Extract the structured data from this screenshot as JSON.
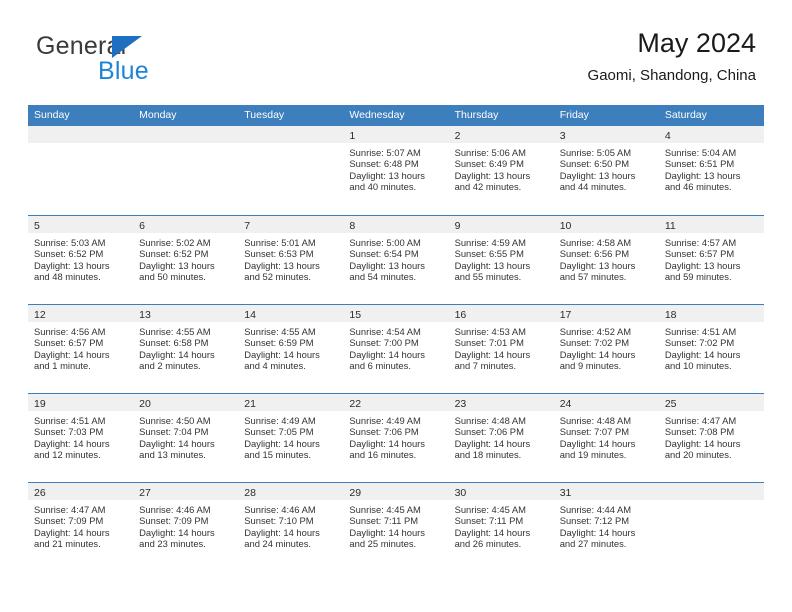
{
  "brand": {
    "word_one": "General",
    "word_two": "Blue",
    "triangle_color": "#1f6fc0",
    "blue_text_color": "#1f84d6"
  },
  "header": {
    "title": "May 2024",
    "location": "Gaomi, Shandong, China"
  },
  "theme": {
    "header_blue": "#3d7ebd",
    "daynum_band": "#f0f0f0",
    "text": "#333333"
  },
  "calendar": {
    "weekday_headers": [
      "Sunday",
      "Monday",
      "Tuesday",
      "Wednesday",
      "Thursday",
      "Friday",
      "Saturday"
    ],
    "weeks": [
      [
        {
          "day": "",
          "empty": true
        },
        {
          "day": "",
          "empty": true
        },
        {
          "day": "",
          "empty": true
        },
        {
          "day": "1",
          "sunrise": "Sunrise: 5:07 AM",
          "sunset": "Sunset: 6:48 PM",
          "daylight_1": "Daylight: 13 hours",
          "daylight_2": "and 40 minutes."
        },
        {
          "day": "2",
          "sunrise": "Sunrise: 5:06 AM",
          "sunset": "Sunset: 6:49 PM",
          "daylight_1": "Daylight: 13 hours",
          "daylight_2": "and 42 minutes."
        },
        {
          "day": "3",
          "sunrise": "Sunrise: 5:05 AM",
          "sunset": "Sunset: 6:50 PM",
          "daylight_1": "Daylight: 13 hours",
          "daylight_2": "and 44 minutes."
        },
        {
          "day": "4",
          "sunrise": "Sunrise: 5:04 AM",
          "sunset": "Sunset: 6:51 PM",
          "daylight_1": "Daylight: 13 hours",
          "daylight_2": "and 46 minutes."
        }
      ],
      [
        {
          "day": "5",
          "sunrise": "Sunrise: 5:03 AM",
          "sunset": "Sunset: 6:52 PM",
          "daylight_1": "Daylight: 13 hours",
          "daylight_2": "and 48 minutes."
        },
        {
          "day": "6",
          "sunrise": "Sunrise: 5:02 AM",
          "sunset": "Sunset: 6:52 PM",
          "daylight_1": "Daylight: 13 hours",
          "daylight_2": "and 50 minutes."
        },
        {
          "day": "7",
          "sunrise": "Sunrise: 5:01 AM",
          "sunset": "Sunset: 6:53 PM",
          "daylight_1": "Daylight: 13 hours",
          "daylight_2": "and 52 minutes."
        },
        {
          "day": "8",
          "sunrise": "Sunrise: 5:00 AM",
          "sunset": "Sunset: 6:54 PM",
          "daylight_1": "Daylight: 13 hours",
          "daylight_2": "and 54 minutes."
        },
        {
          "day": "9",
          "sunrise": "Sunrise: 4:59 AM",
          "sunset": "Sunset: 6:55 PM",
          "daylight_1": "Daylight: 13 hours",
          "daylight_2": "and 55 minutes."
        },
        {
          "day": "10",
          "sunrise": "Sunrise: 4:58 AM",
          "sunset": "Sunset: 6:56 PM",
          "daylight_1": "Daylight: 13 hours",
          "daylight_2": "and 57 minutes."
        },
        {
          "day": "11",
          "sunrise": "Sunrise: 4:57 AM",
          "sunset": "Sunset: 6:57 PM",
          "daylight_1": "Daylight: 13 hours",
          "daylight_2": "and 59 minutes."
        }
      ],
      [
        {
          "day": "12",
          "sunrise": "Sunrise: 4:56 AM",
          "sunset": "Sunset: 6:57 PM",
          "daylight_1": "Daylight: 14 hours",
          "daylight_2": "and 1 minute."
        },
        {
          "day": "13",
          "sunrise": "Sunrise: 4:55 AM",
          "sunset": "Sunset: 6:58 PM",
          "daylight_1": "Daylight: 14 hours",
          "daylight_2": "and 2 minutes."
        },
        {
          "day": "14",
          "sunrise": "Sunrise: 4:55 AM",
          "sunset": "Sunset: 6:59 PM",
          "daylight_1": "Daylight: 14 hours",
          "daylight_2": "and 4 minutes."
        },
        {
          "day": "15",
          "sunrise": "Sunrise: 4:54 AM",
          "sunset": "Sunset: 7:00 PM",
          "daylight_1": "Daylight: 14 hours",
          "daylight_2": "and 6 minutes."
        },
        {
          "day": "16",
          "sunrise": "Sunrise: 4:53 AM",
          "sunset": "Sunset: 7:01 PM",
          "daylight_1": "Daylight: 14 hours",
          "daylight_2": "and 7 minutes."
        },
        {
          "day": "17",
          "sunrise": "Sunrise: 4:52 AM",
          "sunset": "Sunset: 7:02 PM",
          "daylight_1": "Daylight: 14 hours",
          "daylight_2": "and 9 minutes."
        },
        {
          "day": "18",
          "sunrise": "Sunrise: 4:51 AM",
          "sunset": "Sunset: 7:02 PM",
          "daylight_1": "Daylight: 14 hours",
          "daylight_2": "and 10 minutes."
        }
      ],
      [
        {
          "day": "19",
          "sunrise": "Sunrise: 4:51 AM",
          "sunset": "Sunset: 7:03 PM",
          "daylight_1": "Daylight: 14 hours",
          "daylight_2": "and 12 minutes."
        },
        {
          "day": "20",
          "sunrise": "Sunrise: 4:50 AM",
          "sunset": "Sunset: 7:04 PM",
          "daylight_1": "Daylight: 14 hours",
          "daylight_2": "and 13 minutes."
        },
        {
          "day": "21",
          "sunrise": "Sunrise: 4:49 AM",
          "sunset": "Sunset: 7:05 PM",
          "daylight_1": "Daylight: 14 hours",
          "daylight_2": "and 15 minutes."
        },
        {
          "day": "22",
          "sunrise": "Sunrise: 4:49 AM",
          "sunset": "Sunset: 7:06 PM",
          "daylight_1": "Daylight: 14 hours",
          "daylight_2": "and 16 minutes."
        },
        {
          "day": "23",
          "sunrise": "Sunrise: 4:48 AM",
          "sunset": "Sunset: 7:06 PM",
          "daylight_1": "Daylight: 14 hours",
          "daylight_2": "and 18 minutes."
        },
        {
          "day": "24",
          "sunrise": "Sunrise: 4:48 AM",
          "sunset": "Sunset: 7:07 PM",
          "daylight_1": "Daylight: 14 hours",
          "daylight_2": "and 19 minutes."
        },
        {
          "day": "25",
          "sunrise": "Sunrise: 4:47 AM",
          "sunset": "Sunset: 7:08 PM",
          "daylight_1": "Daylight: 14 hours",
          "daylight_2": "and 20 minutes."
        }
      ],
      [
        {
          "day": "26",
          "sunrise": "Sunrise: 4:47 AM",
          "sunset": "Sunset: 7:09 PM",
          "daylight_1": "Daylight: 14 hours",
          "daylight_2": "and 21 minutes."
        },
        {
          "day": "27",
          "sunrise": "Sunrise: 4:46 AM",
          "sunset": "Sunset: 7:09 PM",
          "daylight_1": "Daylight: 14 hours",
          "daylight_2": "and 23 minutes."
        },
        {
          "day": "28",
          "sunrise": "Sunrise: 4:46 AM",
          "sunset": "Sunset: 7:10 PM",
          "daylight_1": "Daylight: 14 hours",
          "daylight_2": "and 24 minutes."
        },
        {
          "day": "29",
          "sunrise": "Sunrise: 4:45 AM",
          "sunset": "Sunset: 7:11 PM",
          "daylight_1": "Daylight: 14 hours",
          "daylight_2": "and 25 minutes."
        },
        {
          "day": "30",
          "sunrise": "Sunrise: 4:45 AM",
          "sunset": "Sunset: 7:11 PM",
          "daylight_1": "Daylight: 14 hours",
          "daylight_2": "and 26 minutes."
        },
        {
          "day": "31",
          "sunrise": "Sunrise: 4:44 AM",
          "sunset": "Sunset: 7:12 PM",
          "daylight_1": "Daylight: 14 hours",
          "daylight_2": "and 27 minutes."
        },
        {
          "day": "",
          "empty": true
        }
      ]
    ]
  }
}
